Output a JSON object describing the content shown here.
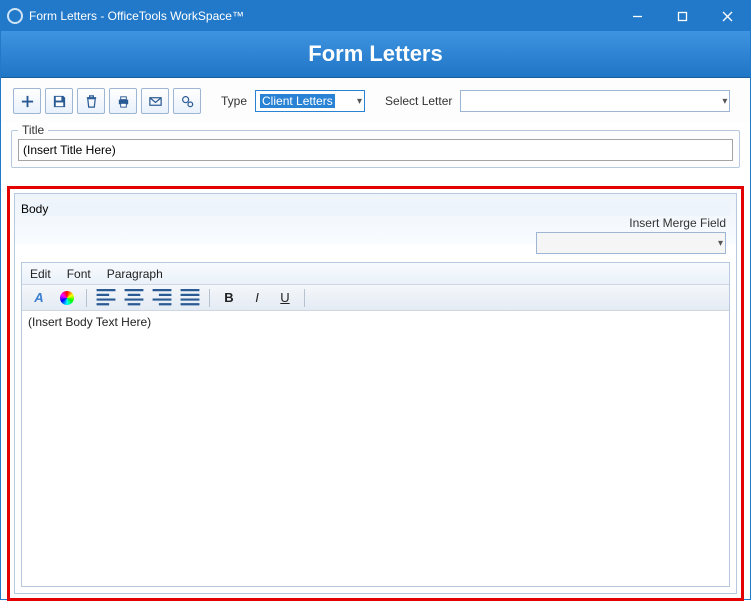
{
  "window": {
    "title": "Form Letters - OfficeTools WorkSpace™"
  },
  "banner": {
    "title": "Form Letters"
  },
  "toolbar": {
    "type_label": "Type",
    "type_value": "Client Letters",
    "select_letter_label": "Select Letter",
    "select_letter_value": ""
  },
  "title_section": {
    "legend": "Title",
    "value": "(Insert Title Here)"
  },
  "body_section": {
    "legend": "Body",
    "merge_label": "Insert Merge Field",
    "merge_value": "",
    "menus": {
      "edit": "Edit",
      "font": "Font",
      "paragraph": "Paragraph"
    },
    "content": "(Insert Body Text Here)"
  }
}
